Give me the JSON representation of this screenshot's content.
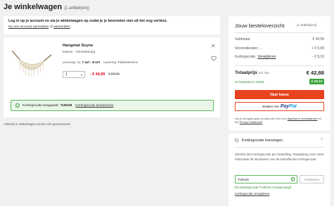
{
  "page": {
    "title": "Je winkelwagen",
    "count": "(1 artikel(en))"
  },
  "notice": {
    "main": "Log in op je account en sla je winkelwagen op zodat je je favorieten niet uit het oog verliest.",
    "create_link": "Nu een account aanmaken",
    "or": "of",
    "login_link": "aanmelden"
  },
  "product": {
    "name": "Hangmat Seyne",
    "variant": "katoen - crèmekleurig",
    "delivery_label": "Levering:",
    "delivery_prefix": "ca.",
    "delivery_range": "7 wrt - 8 wrt",
    "service_label": "Levering: Pakketservice",
    "quantity": "1",
    "price_now": "- € 44,99",
    "price_old": "€ 69,99"
  },
  "coupon_applied": {
    "text": "Kortingscode toegepast:",
    "code": "TUIN18",
    "deactivate_link": "Kortingscode deactiveren"
  },
  "saved_note": "Artikelen in winkelwagen worden niet gereserveerd.",
  "summary": {
    "title": "Jouw besteloverzicht",
    "count": "(1 artikel(en))",
    "subtotal_label": "Subtotaal",
    "subtotal_value": "€ 44,99",
    "shipping_label": "Verzendkosten",
    "shipping_value": "+ € 5,99",
    "discount_label": "Kortingscode",
    "discount_remove": "Verwijderen",
    "discount_value": "- € 8,10",
    "total_label": "Totaalprijs",
    "total_incl": "incl. btw",
    "total_value": "€ 42,88",
    "saved_label": "Je bespaart in totaal",
    "saved_value": "€ 33,10",
    "checkout_button": "Naar kassa",
    "paypal_prefix": "Betalen met",
    "paypal_brand_1": "Pay",
    "paypal_brand_2": "Pal",
    "terms_1": "Als je doorgaat gaan je akkoord met onze",
    "terms_link_1": "Algemene Voorwaarden",
    "terms_2": "en het",
    "terms_link_2": "Privacy Statement"
  },
  "promo": {
    "title": "Kortingscode toevoegen",
    "text": "Slechts één kortingscode per bestelling. Raadpleeg voor meer informatie de disclaimer van de betreffende kortingscode.",
    "input_value": "TUIN18",
    "apply_button": "Verzilveren",
    "success": "De kortingscode TUIN18 is toegevoegd",
    "remove_link": "Kortingscode verwijderen"
  },
  "colors": {
    "accent": "#e8431f",
    "price": "#e2001a",
    "success": "#3aa53a"
  }
}
